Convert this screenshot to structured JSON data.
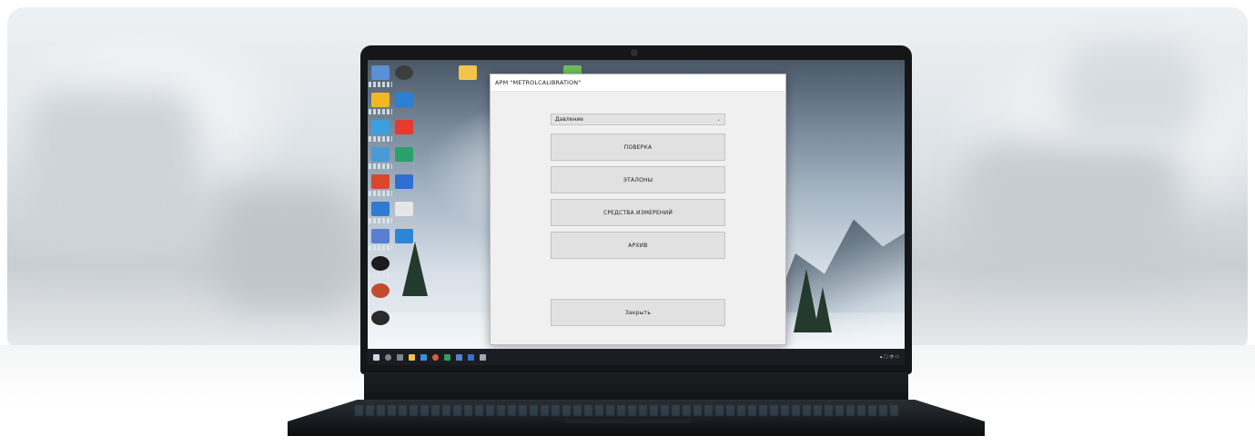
{
  "window": {
    "title": "АРМ \"METROLCALIBRATION\""
  },
  "form": {
    "measurement_type": "Давление",
    "buttons": {
      "verification": "ПОВЕРКА",
      "standards": "ЭТАЛОНЫ",
      "instruments": "СРЕДСТВА ИЗМЕРЕНИЙ",
      "archive": "АРХИВ",
      "close": "Закрыть"
    }
  },
  "colors": {
    "window_bg": "#f0f0f0",
    "button_bg": "#e1e1e1",
    "taskbar": "#1a1d22",
    "laptop": "#141618"
  },
  "icons": [
    "camera-icon",
    "chevron-down-icon",
    "desktop-app-icons",
    "taskbar-start-icon"
  ]
}
